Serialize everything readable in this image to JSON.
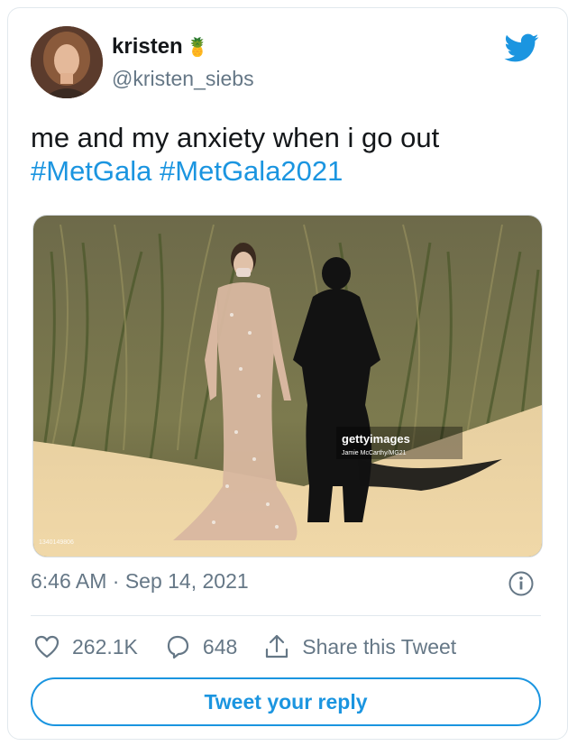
{
  "author": {
    "display_name": "kristen",
    "emoji": "🍍",
    "handle": "@kristen_siebs"
  },
  "tweet": {
    "text": "me and my anxiety when i go out",
    "hashtags": [
      "#MetGala",
      "#MetGala2021"
    ],
    "timestamp": "6:46 AM · Sep 14, 2021"
  },
  "photo": {
    "watermark_brand": "gettyimages",
    "watermark_credit": "Jamie McCarthy/MG21",
    "image_id": "1340149806"
  },
  "actions": {
    "likes": "262.1K",
    "replies": "648",
    "share_label": "Share this Tweet"
  },
  "reply_button_label": "Tweet your reply",
  "colors": {
    "accent": "#1b95e0",
    "secondary_text": "#657786",
    "border": "#e1e8ed"
  },
  "icons": [
    "twitter-bird-icon",
    "info-icon",
    "heart-icon",
    "reply-icon",
    "share-icon"
  ]
}
